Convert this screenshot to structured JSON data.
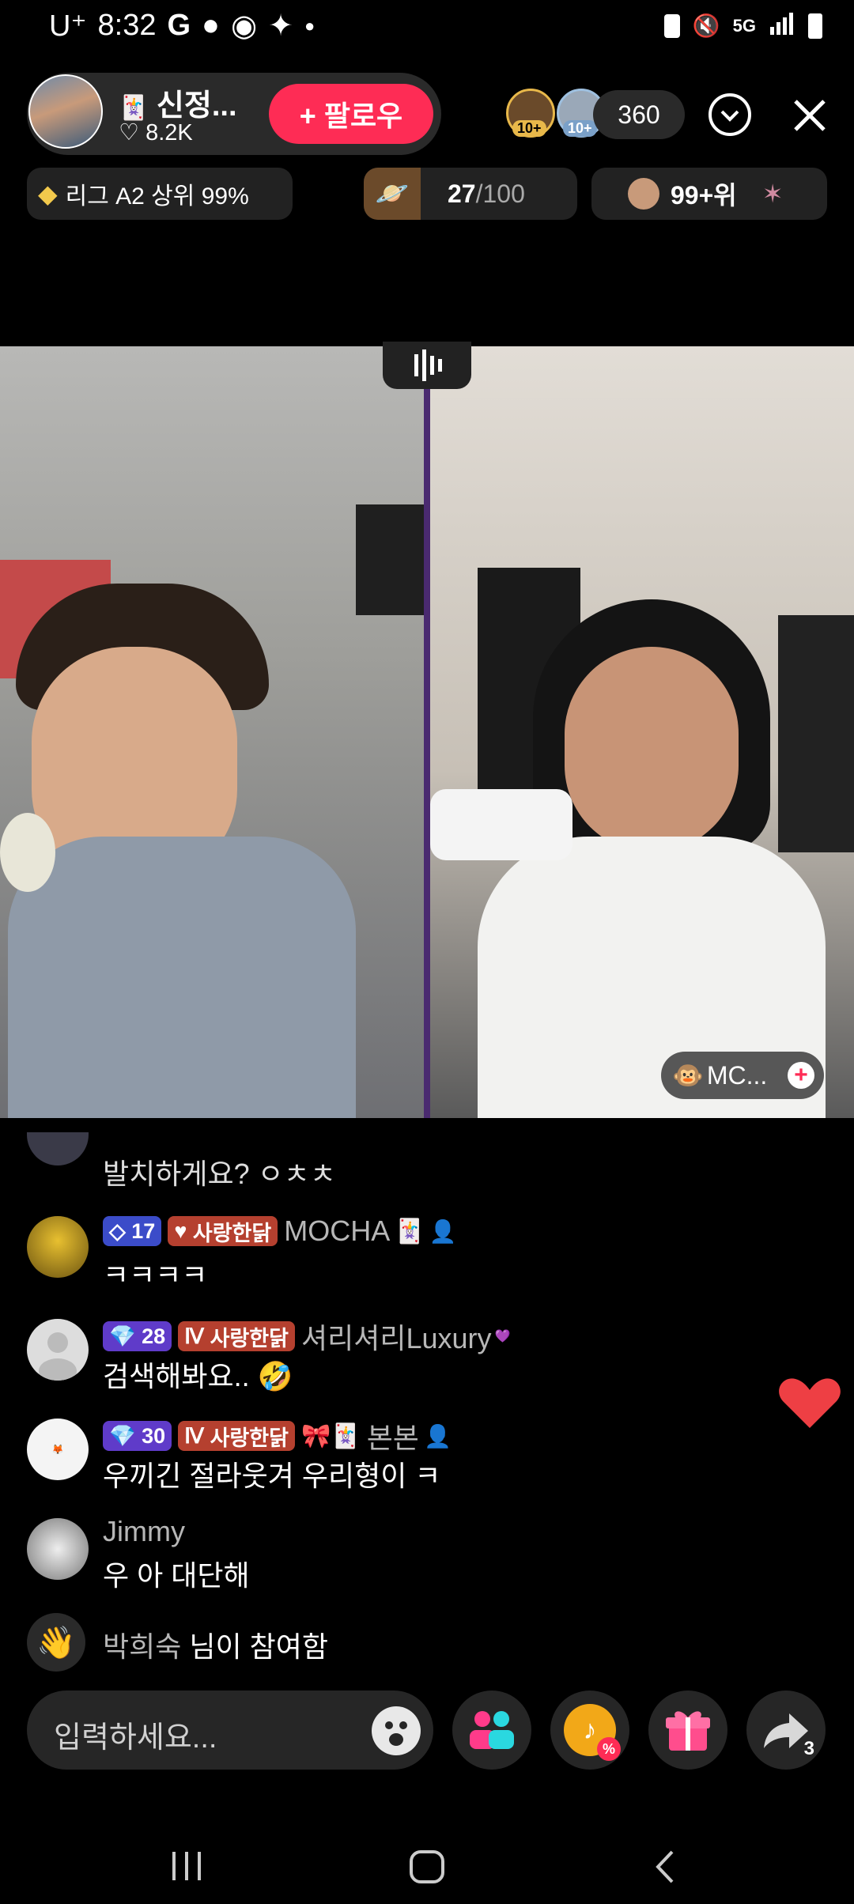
{
  "status_bar": {
    "carrier": "U⁺",
    "time": "8:32",
    "network": "5G"
  },
  "host": {
    "name": "신정...",
    "likes": "8.2K",
    "follow_label": "+ 팔로우"
  },
  "viewers": {
    "badge1": "10+",
    "badge2": "10+",
    "count": "360"
  },
  "league": {
    "label": "리그 A2 상위 99%"
  },
  "goal": {
    "current": "27",
    "total": "/100"
  },
  "rank": {
    "label": "99+위"
  },
  "mc_tag": {
    "label": "MC..."
  },
  "chat": [
    {
      "name": "",
      "message": "발치하게요? ㅇㅊㅊ"
    },
    {
      "level": "17",
      "badge": "사랑한닭",
      "name": "MOCHA",
      "message": "ㅋㅋㅋㅋ"
    },
    {
      "level": "28",
      "badge": "사랑한닭",
      "name": "셔리셔리Luxury",
      "message": "검색해봐요.. 🤣"
    },
    {
      "level": "30",
      "badge": "사랑한닭",
      "name": "본본",
      "message": "우끼긴 절라웃겨 우리형이 ㅋ"
    },
    {
      "name": "Jimmy",
      "message": "우  아 대단해"
    },
    {
      "name": "박희숙",
      "message": "님이 참여함"
    }
  ],
  "input": {
    "placeholder": "입력하세요..."
  },
  "share_count": "3",
  "icons": [
    "chevron-down-icon",
    "close-icon",
    "heart-icon",
    "audio-icon",
    "emoji-icon",
    "people-icon",
    "tiktok-coupon-icon",
    "gift-icon",
    "share-icon",
    "nav-recents-icon",
    "nav-home-icon",
    "nav-back-icon"
  ],
  "colors": {
    "follow": "#fe2c55",
    "accent_purple": "#4a2a70",
    "heart": "#ee3f44"
  }
}
